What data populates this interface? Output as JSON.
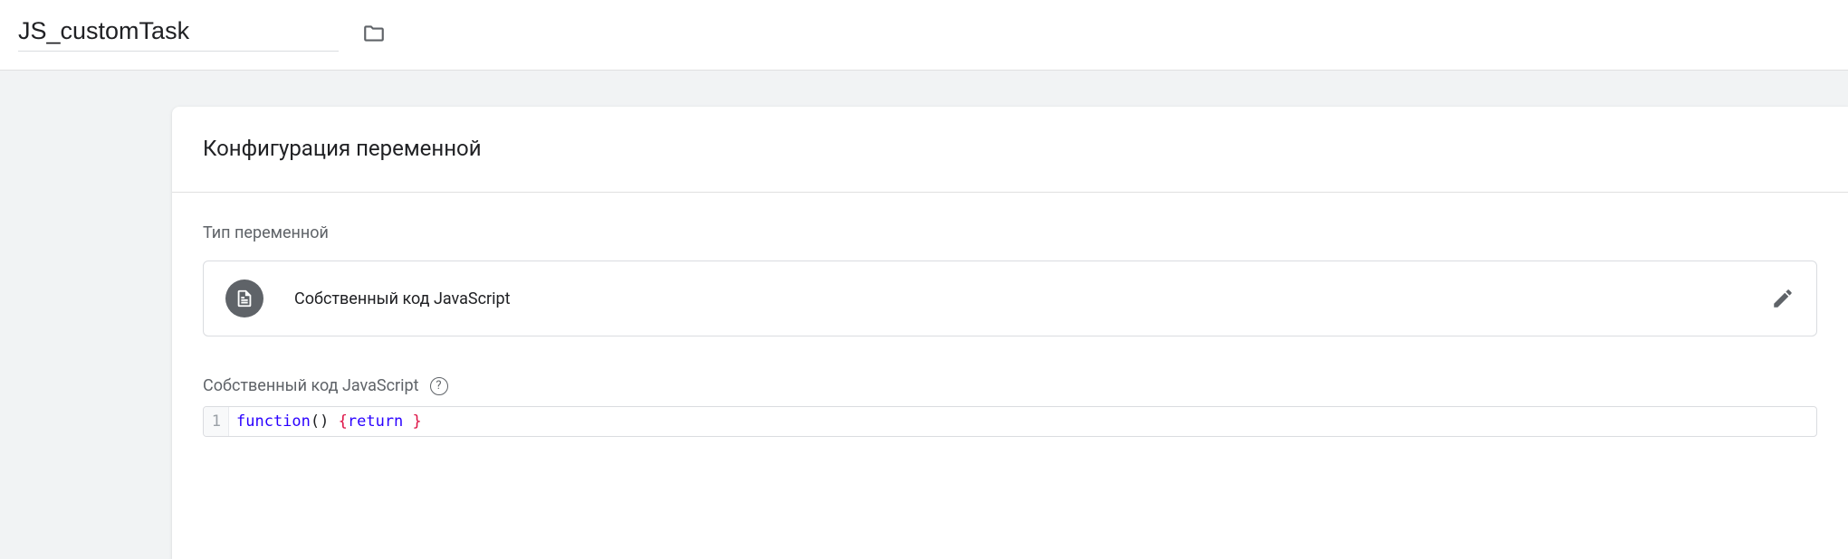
{
  "header": {
    "title_value": "JS_customTask"
  },
  "card": {
    "title": "Конфигурация переменной",
    "type_section_label": "Тип переменной",
    "type_name": "Собственный код JavaScript",
    "code_section_label": "Собственный код JavaScript",
    "editor": {
      "line_number": "1",
      "kw_function": "function",
      "paren": "()",
      "brace_open": "{",
      "kw_return": "return",
      "brace_close": "}"
    }
  }
}
